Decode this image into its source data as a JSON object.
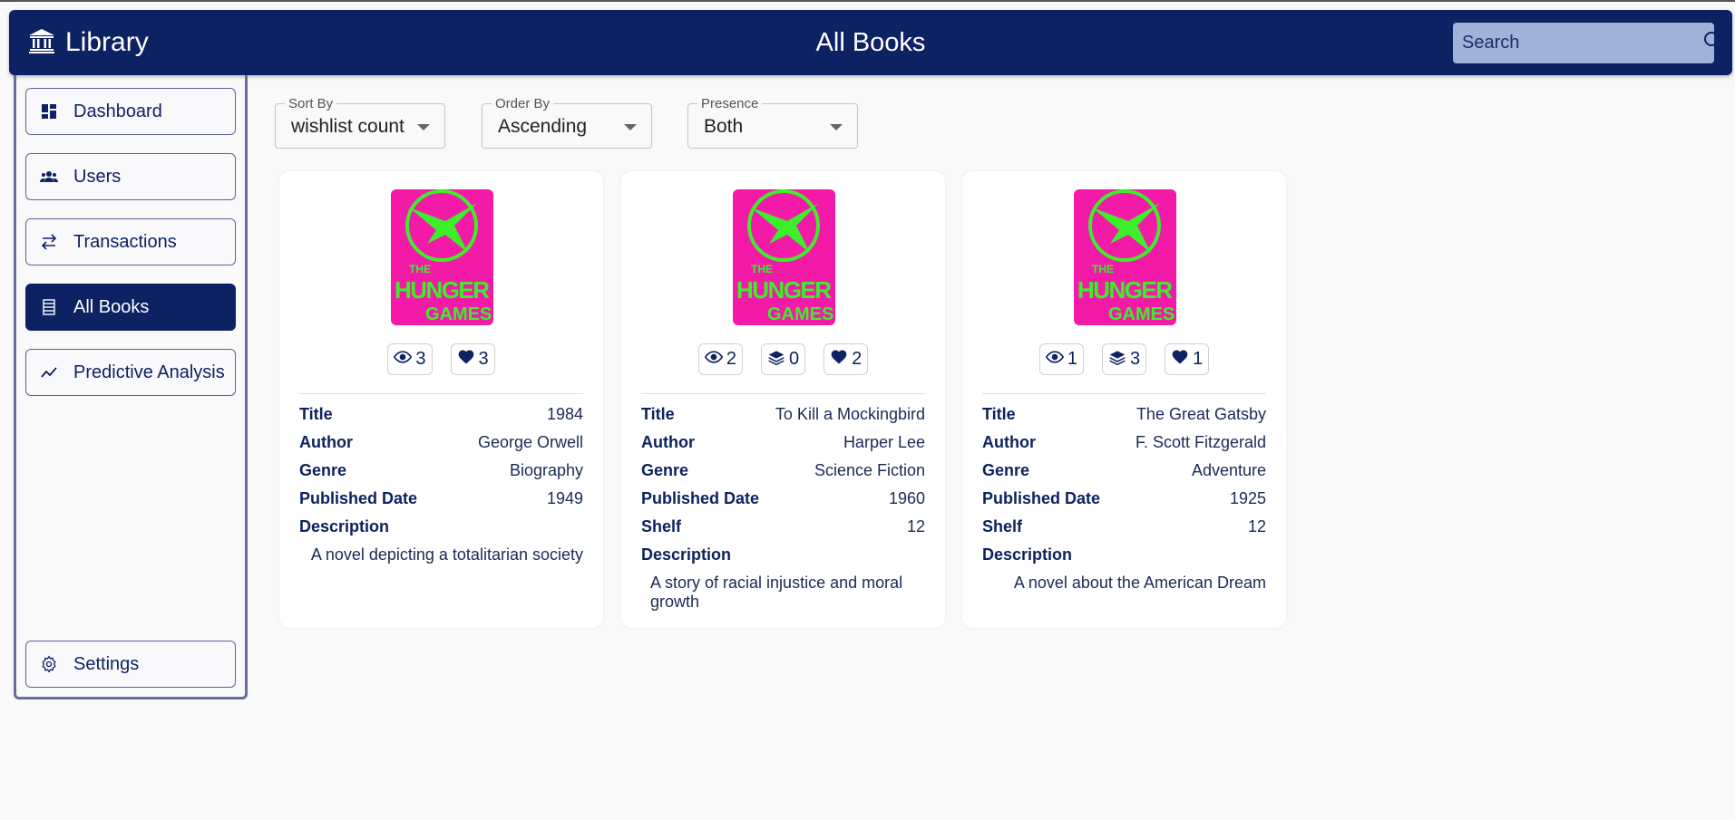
{
  "header": {
    "brand": "Library",
    "title": "All Books",
    "search_placeholder": "Search"
  },
  "sidebar": {
    "items": [
      {
        "label": "Dashboard",
        "icon": "dashboard-icon",
        "active": false
      },
      {
        "label": "Users",
        "icon": "users-icon",
        "active": false
      },
      {
        "label": "Transactions",
        "icon": "transactions-icon",
        "active": false
      },
      {
        "label": "All Books",
        "icon": "books-icon",
        "active": true
      },
      {
        "label": "Predictive Analysis",
        "icon": "trend-icon",
        "active": false
      }
    ],
    "settings": {
      "label": "Settings",
      "icon": "gear-icon"
    }
  },
  "filters": {
    "sort_by": {
      "label": "Sort By",
      "value": "wishlist count"
    },
    "order_by": {
      "label": "Order By",
      "value": "Ascending"
    },
    "presence": {
      "label": "Presence",
      "value": "Both"
    }
  },
  "labels": {
    "title": "Title",
    "author": "Author",
    "genre": "Genre",
    "published": "Published Date",
    "shelf": "Shelf",
    "description": "Description"
  },
  "colors": {
    "primary": "#0d2262",
    "search_bg": "#a1b1d7",
    "cover_pink": "#f21aa6",
    "cover_green": "#3bf02a"
  },
  "books": [
    {
      "cover_text": [
        "THE",
        "HUNGER",
        "GAMES"
      ],
      "views": "3",
      "copies": null,
      "wishlist": "3",
      "title": "1984",
      "author": "George Orwell",
      "genre": "Biography",
      "published": "1949",
      "shelf": null,
      "description": "A novel depicting a totalitarian society"
    },
    {
      "cover_text": [
        "THE",
        "HUNGER",
        "GAMES"
      ],
      "views": "2",
      "copies": "0",
      "wishlist": "2",
      "title": "To Kill a Mockingbird",
      "author": "Harper Lee",
      "genre": "Science Fiction",
      "published": "1960",
      "shelf": "12",
      "description": "A story of racial injustice and moral growth"
    },
    {
      "cover_text": [
        "THE",
        "HUNGER",
        "GAMES"
      ],
      "views": "1",
      "copies": "3",
      "wishlist": "1",
      "title": "The Great Gatsby",
      "author": "F. Scott Fitzgerald",
      "genre": "Adventure",
      "published": "1925",
      "shelf": "12",
      "description": "A novel about the American Dream"
    }
  ]
}
